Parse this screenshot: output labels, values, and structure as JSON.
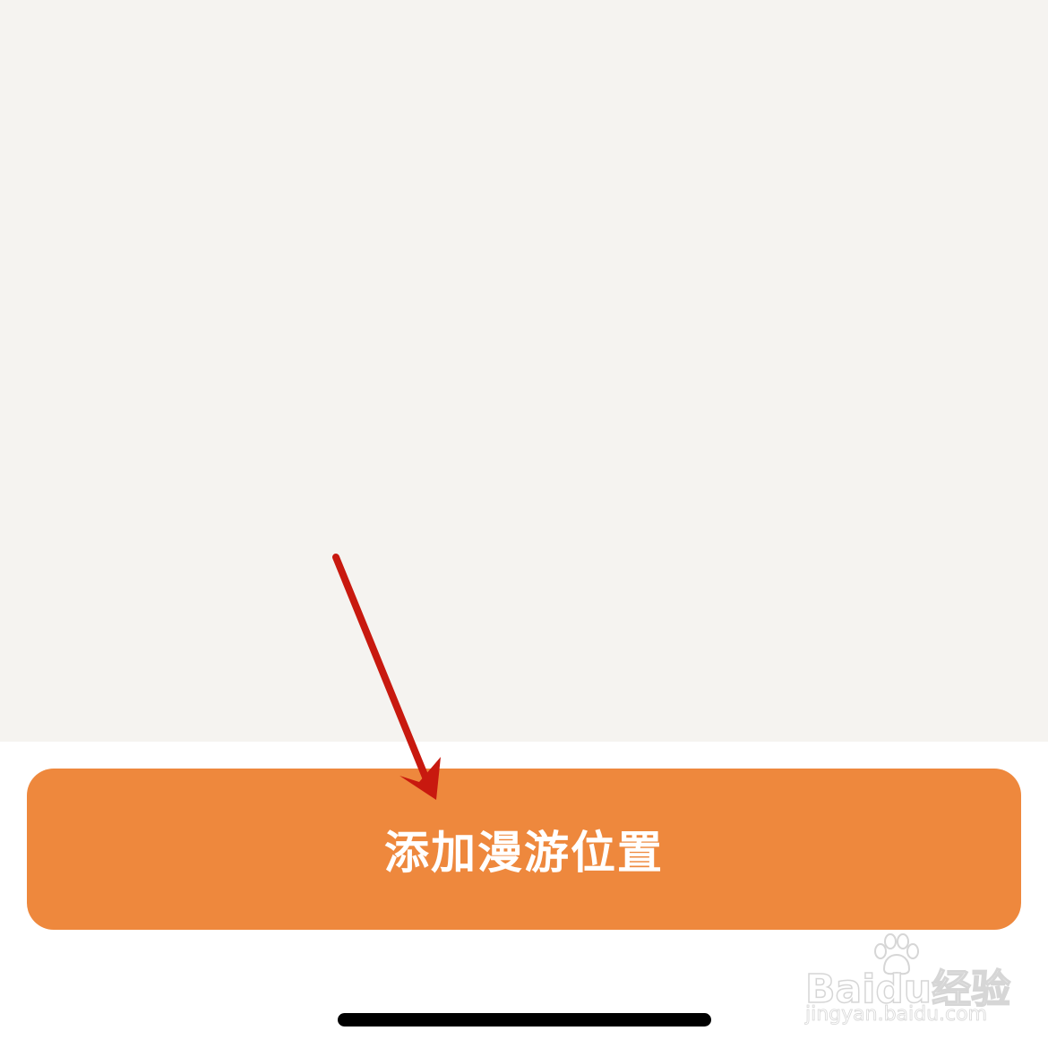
{
  "button": {
    "label": "添加漫游位置"
  },
  "watermark": {
    "brand_latin": "Bai",
    "brand_du": "du",
    "brand_cn": "经验",
    "url": "jingyan.baidu.com"
  },
  "colors": {
    "content_background": "#f5f3f0",
    "button_background": "#ee883d",
    "button_text": "#ffffff",
    "annotation_arrow": "#c8190f",
    "home_indicator": "#000000"
  },
  "icons": {
    "annotation": "red-arrow-pointing-down",
    "watermark": "baidu-paw-icon"
  }
}
